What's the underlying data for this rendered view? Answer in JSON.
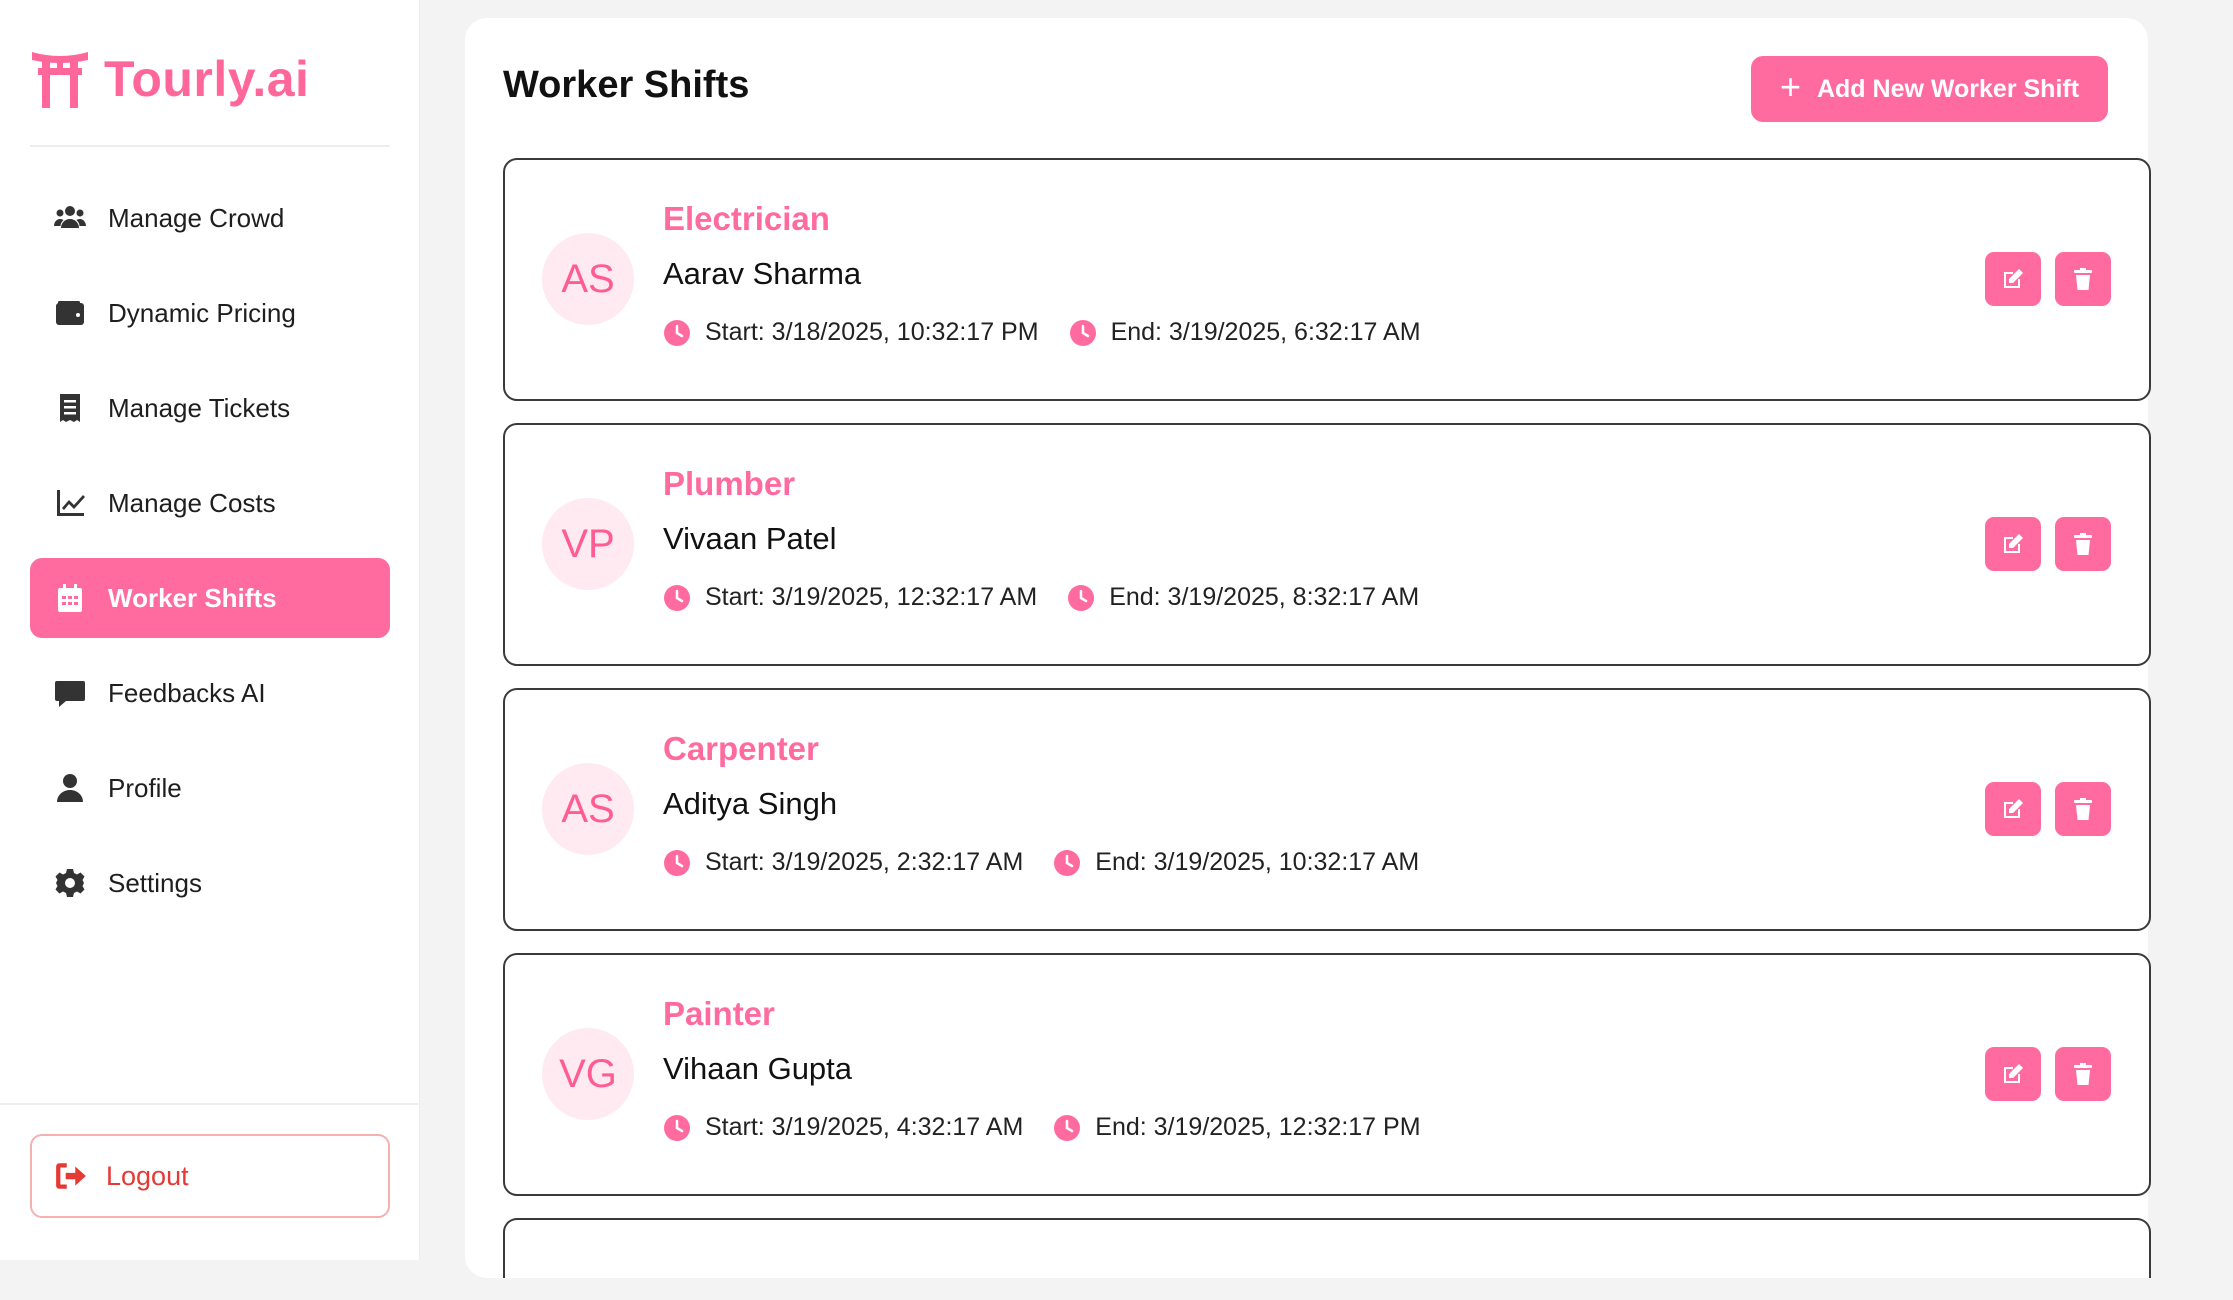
{
  "brand": {
    "name": "Tourly.ai",
    "color": "#ff679b"
  },
  "sidebar": {
    "items": [
      {
        "label": "Manage Crowd",
        "icon": "users-icon",
        "active": false
      },
      {
        "label": "Dynamic Pricing",
        "icon": "wallet-icon",
        "active": false
      },
      {
        "label": "Manage Tickets",
        "icon": "receipt-icon",
        "active": false
      },
      {
        "label": "Manage Costs",
        "icon": "chart-line-icon",
        "active": false
      },
      {
        "label": "Worker Shifts",
        "icon": "calendar-icon",
        "active": true
      },
      {
        "label": "Feedbacks AI",
        "icon": "comment-icon",
        "active": false
      },
      {
        "label": "Profile",
        "icon": "user-icon",
        "active": false
      },
      {
        "label": "Settings",
        "icon": "gear-icon",
        "active": false
      }
    ],
    "logout_label": "Logout"
  },
  "main": {
    "title": "Worker Shifts",
    "add_button_label": "Add New Worker Shift",
    "shifts": [
      {
        "initials": "AS",
        "role": "Electrician",
        "name": "Aarav Sharma",
        "start": "Start: 3/18/2025, 10:32:17 PM",
        "end": "End: 3/19/2025, 6:32:17 AM"
      },
      {
        "initials": "VP",
        "role": "Plumber",
        "name": "Vivaan Patel",
        "start": "Start: 3/19/2025, 12:32:17 AM",
        "end": "End: 3/19/2025, 8:32:17 AM"
      },
      {
        "initials": "AS",
        "role": "Carpenter",
        "name": "Aditya Singh",
        "start": "Start: 3/19/2025, 2:32:17 AM",
        "end": "End: 3/19/2025, 10:32:17 AM"
      },
      {
        "initials": "VG",
        "role": "Painter",
        "name": "Vihaan Gupta",
        "start": "Start: 3/19/2025, 4:32:17 AM",
        "end": "End: 3/19/2025, 12:32:17 PM"
      }
    ]
  },
  "colors": {
    "accent": "#ff6b9f",
    "logout": "#e53935",
    "avatar_bg": "#ffeaf1"
  }
}
